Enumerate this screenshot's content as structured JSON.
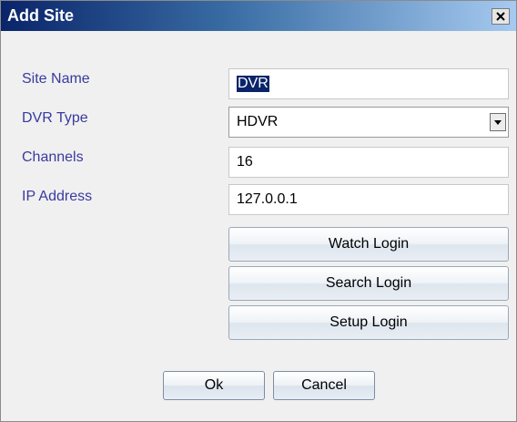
{
  "window": {
    "title": "Add Site"
  },
  "form": {
    "site_name_label": "Site Name",
    "site_name_value": "DVR",
    "dvr_type_label": "DVR Type",
    "dvr_type_value": "HDVR",
    "channels_label": "Channels",
    "channels_value": "16",
    "ip_address_label": "IP Address",
    "ip_address_value": "127.0.0.1"
  },
  "logins": {
    "watch_label": "Watch Login",
    "search_label": "Search Login",
    "setup_label": "Setup Login"
  },
  "actions": {
    "ok_label": "Ok",
    "cancel_label": "Cancel"
  },
  "icons": {
    "close": "close-icon",
    "dropdown": "chevron-down-icon"
  },
  "colors": {
    "title_start": "#0a246a",
    "title_end": "#a6caf0",
    "label_text": "#3a3aa0",
    "selection": "#0a246a"
  }
}
